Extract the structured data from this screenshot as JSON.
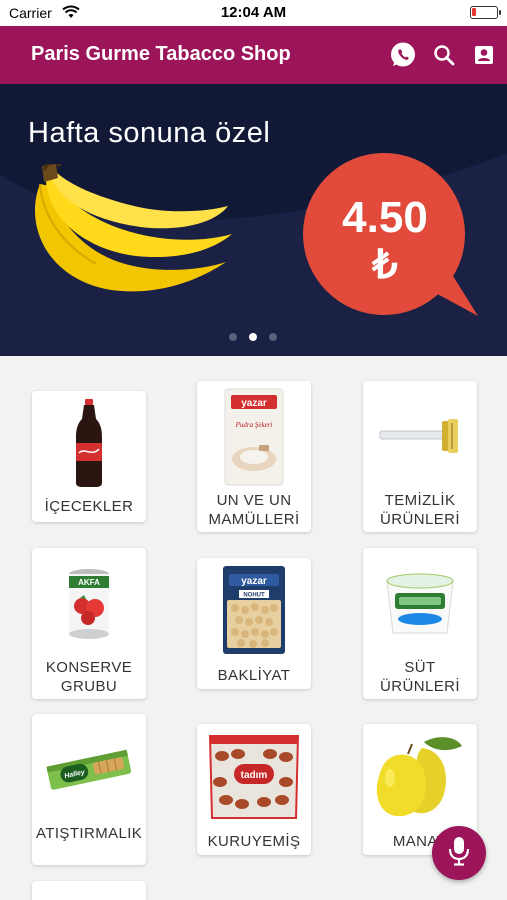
{
  "status_bar": {
    "carrier": "Carrier",
    "time": "12:04 AM"
  },
  "app_bar": {
    "title": "Paris Gurme Tabacco Shop",
    "actions": [
      "whatsapp-icon",
      "search-icon",
      "contact-icon"
    ],
    "color": "#9c145a"
  },
  "banner": {
    "headline": "Hafta sonuna özel",
    "price": "4.50",
    "currency": "₺",
    "price_bubble_color": "#e24b3b",
    "background_color": "#121936",
    "slide_count": 3,
    "active_slide": 2
  },
  "categories": [
    {
      "label": "İÇECEKLER"
    },
    {
      "label": "UN VE UN MAMÜLLERİ"
    },
    {
      "label": "TEMİZLİK ÜRÜNLERİ"
    },
    {
      "label": "KONSERVE GRUBU"
    },
    {
      "label": "BAKLİYAT"
    },
    {
      "label": "SÜT ÜRÜNLERİ"
    },
    {
      "label": "ATIŞTIRMALIK"
    },
    {
      "label": "KURUYEMİŞ"
    },
    {
      "label": "MANAV"
    }
  ],
  "product_labels": {
    "un_brand": "yazar",
    "un_product": "Pudra Şekeri",
    "bakliyat_brand": "yazar",
    "bakliyat_product": "NOHUT",
    "konserve_brand": "AKFA",
    "atistirmalik_brand": "Halley",
    "kuruyemis_brand": "tadım"
  },
  "fab": {
    "icon": "microphone-icon"
  }
}
